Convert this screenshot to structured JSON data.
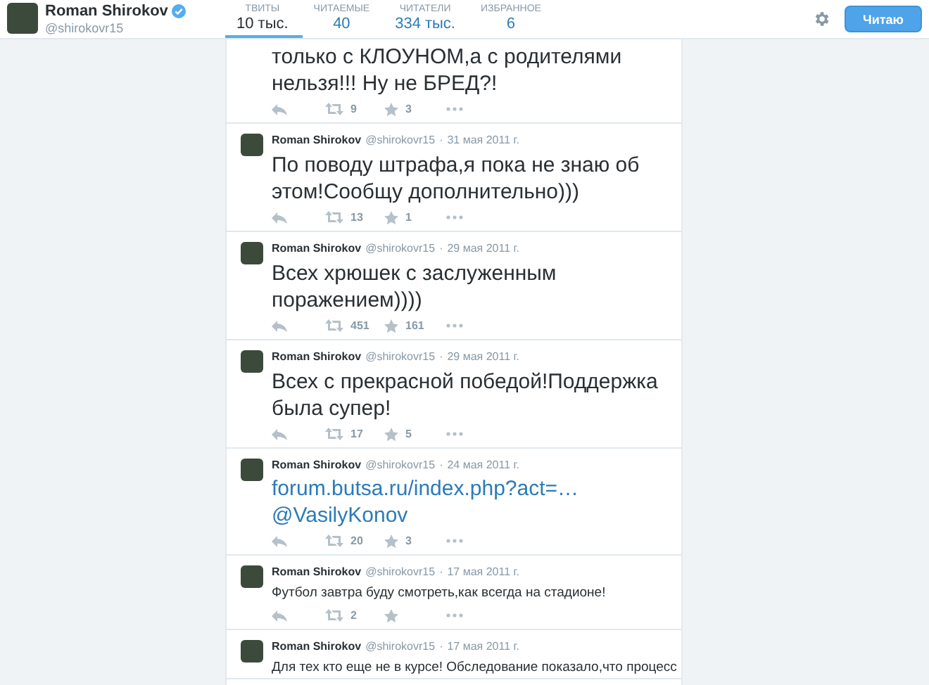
{
  "profile": {
    "name": "Roman Shirokov",
    "handle": "@shirokovr15",
    "verified": true
  },
  "tabs": [
    {
      "label": "ТВИТЫ",
      "value": "10 тыс.",
      "selected": true
    },
    {
      "label": "ЧИТАЕМЫЕ",
      "value": "40",
      "selected": false
    },
    {
      "label": "ЧИТАТЕЛИ",
      "value": "334 тыс.",
      "selected": false
    },
    {
      "label": "ИЗБРАННОЕ",
      "value": "6",
      "selected": false
    }
  ],
  "follow_button": "Читаю",
  "tweets": [
    {
      "kind": "large",
      "lines": [
        "только с КЛОУНОМ,а с родителями",
        "нельзя!!! Ну не БРЕД?!"
      ],
      "retweets": "9",
      "favorites": "3"
    },
    {
      "kind": "large",
      "name": "Roman Shirokov",
      "handle": "@shirokovr15",
      "separator": "·",
      "date": "31 мая 2011 г.",
      "lines": [
        "По поводу штрафа,я пока не знаю об",
        "этом!Сообщу дополнительно)))"
      ],
      "retweets": "13",
      "favorites": "1"
    },
    {
      "kind": "large",
      "name": "Roman Shirokov",
      "handle": "@shirokovr15",
      "separator": "·",
      "date": "29 мая 2011 г.",
      "lines": [
        "Всех хрюшек с заслуженным",
        "поражением))))"
      ],
      "retweets": "451",
      "favorites": "161"
    },
    {
      "kind": "large",
      "name": "Roman Shirokov",
      "handle": "@shirokovr15",
      "separator": "·",
      "date": "29 мая 2011 г.",
      "lines": [
        "Всех с прекрасной победой!Поддержка",
        "была супер!"
      ],
      "retweets": "17",
      "favorites": "5"
    },
    {
      "kind": "links",
      "name": "Roman Shirokov",
      "handle": "@shirokovr15",
      "separator": "·",
      "date": "24 мая 2011 г.",
      "lines": [
        "forum.butsa.ru/index.php?act=…",
        "@VasilyKonov"
      ],
      "retweets": "20",
      "favorites": "3"
    },
    {
      "kind": "small",
      "name": "Roman Shirokov",
      "handle": "@shirokovr15",
      "separator": "·",
      "date": "17 мая 2011 г.",
      "lines": [
        "Футбол завтра буду смотреть,как всегда на стадионе!"
      ],
      "retweets": "2"
    },
    {
      "kind": "small",
      "name": "Roman Shirokov",
      "handle": "@shirokovr15",
      "separator": "·",
      "date": "17 мая 2011 г.",
      "lines": [
        "Для тех кто еще не в курсе! Обследование показало,что процесс"
      ]
    }
  ]
}
